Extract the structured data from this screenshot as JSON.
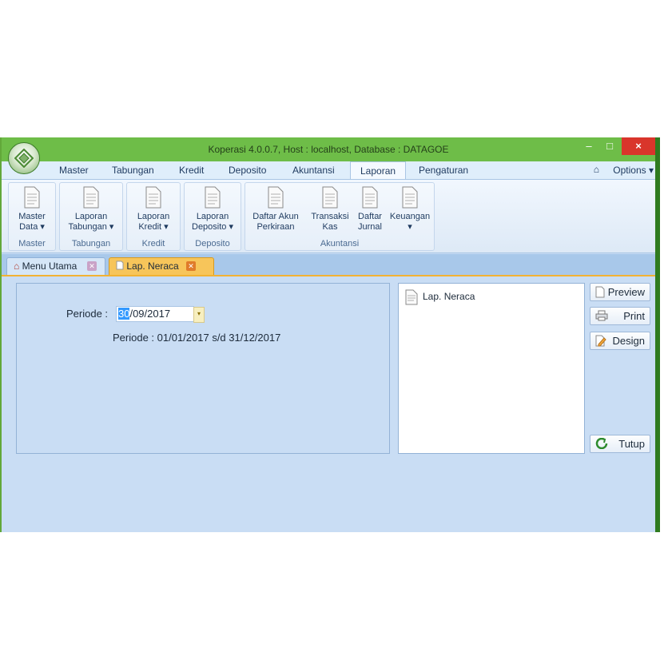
{
  "window": {
    "title": "Koperasi 4.0.0.7, Host : localhost, Database : DATAGOE",
    "controls": {
      "minimize": "–",
      "maximize": "□",
      "close": "×"
    }
  },
  "ribbon_tabs": [
    "Master",
    "Tabungan",
    "Kredit",
    "Deposito",
    "Akuntansi",
    "Laporan",
    "Pengaturan"
  ],
  "active_ribbon_tab": "Laporan",
  "options_label": "Options",
  "ribbon_groups": [
    {
      "label": "Master",
      "buttons": [
        {
          "line1": "Master",
          "line2": "Data ▾"
        }
      ]
    },
    {
      "label": "Tabungan",
      "buttons": [
        {
          "line1": "Laporan",
          "line2": "Tabungan ▾"
        }
      ]
    },
    {
      "label": "Kredit",
      "buttons": [
        {
          "line1": "Laporan",
          "line2": "Kredit ▾"
        }
      ]
    },
    {
      "label": "Deposito",
      "buttons": [
        {
          "line1": "Laporan",
          "line2": "Deposito ▾"
        }
      ]
    },
    {
      "label": "Akuntansi",
      "buttons": [
        {
          "line1": "Daftar Akun",
          "line2": "Perkiraan"
        },
        {
          "line1": "Transaksi",
          "line2": "Kas"
        },
        {
          "line1": "Daftar",
          "line2": "Jurnal"
        },
        {
          "line1": "Keuangan",
          "line2": "▾"
        }
      ]
    }
  ],
  "page_tabs": [
    {
      "label": "Menu Utama"
    },
    {
      "label": "Lap. Neraca"
    }
  ],
  "form": {
    "periode_label": "Periode :",
    "date_selected": "30",
    "date_rest": "/09/2017",
    "periode_info": "Periode : 01/01/2017 s/d 31/12/2017"
  },
  "report_list": [
    "Lap. Neraca"
  ],
  "buttons": {
    "preview": "Preview",
    "print": "Print",
    "design": "Design",
    "tutup": "Tutup"
  },
  "colors": {
    "titlebar": "#6ebd48",
    "close": "#d9352b",
    "background": "#c9ddf4",
    "active_tab": "#f7c55a"
  }
}
